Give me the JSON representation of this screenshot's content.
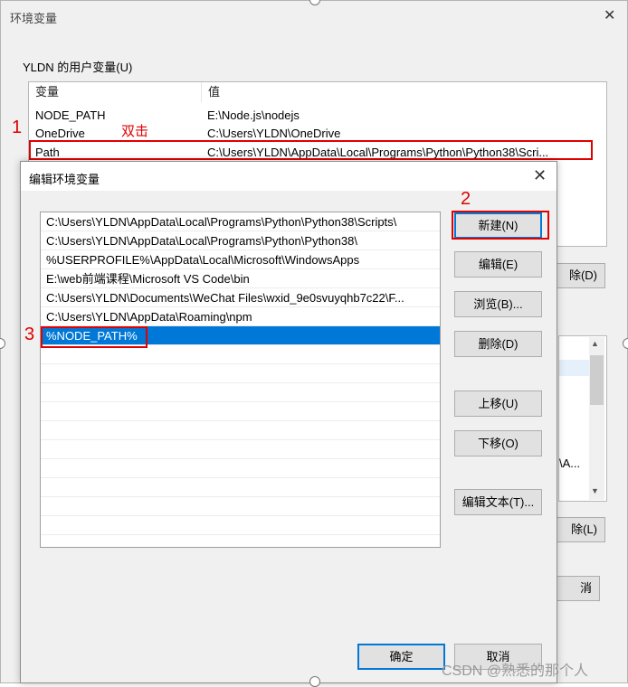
{
  "bg_window": {
    "title": "环境变量",
    "close_glyph": "✕",
    "group_label": "YLDN 的用户变量(U)",
    "columns": [
      "变量",
      "值"
    ],
    "rows": [
      {
        "name": "NODE_PATH",
        "value": "E:\\Node.js\\nodejs"
      },
      {
        "name": "OneDrive",
        "value": "C:\\Users\\YLDN\\OneDrive"
      },
      {
        "name": "Path",
        "value": "C:\\Users\\YLDN\\AppData\\Local\\Programs\\Python\\Python38\\Scri..."
      }
    ],
    "partial_buttons": [
      "除(D)",
      "除(L)",
      "消"
    ],
    "partial_text": "\\A...",
    "scroll_up": "▲",
    "scroll_down": "▼"
  },
  "annotations": {
    "mark_1": "1",
    "mark_1_note": "双击",
    "mark_2": "2",
    "mark_3": "3",
    "color": "#e00000"
  },
  "dialog": {
    "title": "编辑环境变量",
    "close_glyph": "✕",
    "items": [
      "C:\\Users\\YLDN\\AppData\\Local\\Programs\\Python\\Python38\\Scripts\\",
      "C:\\Users\\YLDN\\AppData\\Local\\Programs\\Python\\Python38\\",
      "%USERPROFILE%\\AppData\\Local\\Microsoft\\WindowsApps",
      "E:\\web前端课程\\Microsoft VS Code\\bin",
      "C:\\Users\\YLDN\\Documents\\WeChat Files\\wxid_9e0svuyqhb7c22\\F...",
      "C:\\Users\\YLDN\\AppData\\Roaming\\npm",
      "%NODE_PATH%"
    ],
    "selected_index": 6,
    "buttons": {
      "new": "新建(N)",
      "edit": "编辑(E)",
      "browse": "浏览(B)...",
      "delete": "删除(D)",
      "up": "上移(U)",
      "down": "下移(O)",
      "edit_text": "编辑文本(T)...",
      "ok": "确定",
      "cancel": "取消"
    },
    "accent_color": "#0078d7"
  },
  "watermark": "CSDN @熟悉的那个人"
}
